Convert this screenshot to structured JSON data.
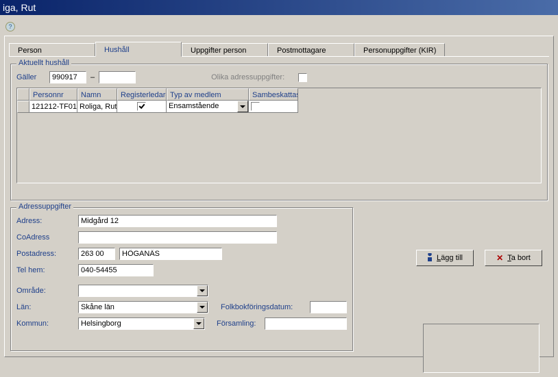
{
  "title": "iga, Rut",
  "tabs": {
    "person": "Person",
    "hushall": "Hushåll",
    "uppgifter_person": "Uppgifter person",
    "postmottagare": "Postmottagare",
    "personuppgifter_kir": "Personuppgifter (KIR)"
  },
  "group_aktuellt": {
    "title": "Aktuellt hushåll",
    "galler_label": "Gäller",
    "galler_from": "990917",
    "galler_to": "",
    "olika_label": "Olika adressuppgifter:",
    "olika_checked": false,
    "table": {
      "headers": {
        "personnr": "Personnr",
        "namn": "Namn",
        "registerledare": "Registerledare",
        "typ_av_medlem": "Typ av medlem",
        "sambeskattas": "Sambeskattas"
      },
      "row": {
        "personnr": "121212-TF01",
        "namn": "Roliga, Rut",
        "registerledare_checked": true,
        "typ_av_medlem": "Ensamstående",
        "sambeskattas_checked": false
      }
    }
  },
  "group_adress": {
    "title": "Adressuppgifter",
    "labels": {
      "adress": "Adress:",
      "coadress": "CoAdress",
      "postadress": "Postadress:",
      "telhem": "Tel hem:",
      "omrade": "Område:",
      "lan": "Län:",
      "kommun": "Kommun:",
      "folkbok": "Folkbokföringsdatum:",
      "forsamling": "Församling:"
    },
    "values": {
      "adress": "Midgård 12",
      "coadress": "",
      "post_nr": "263 00",
      "post_ort": "HÖGANÄS",
      "telhem": "040-54455",
      "omrade": "",
      "lan": "Skåne län",
      "kommun": "Helsingborg",
      "folkbok": "",
      "forsamling": ""
    }
  },
  "buttons": {
    "lagg_till_pre": "L",
    "lagg_till_rest": "ägg till",
    "ta_bort_pre": "T",
    "ta_bort_rest": "a bort"
  }
}
